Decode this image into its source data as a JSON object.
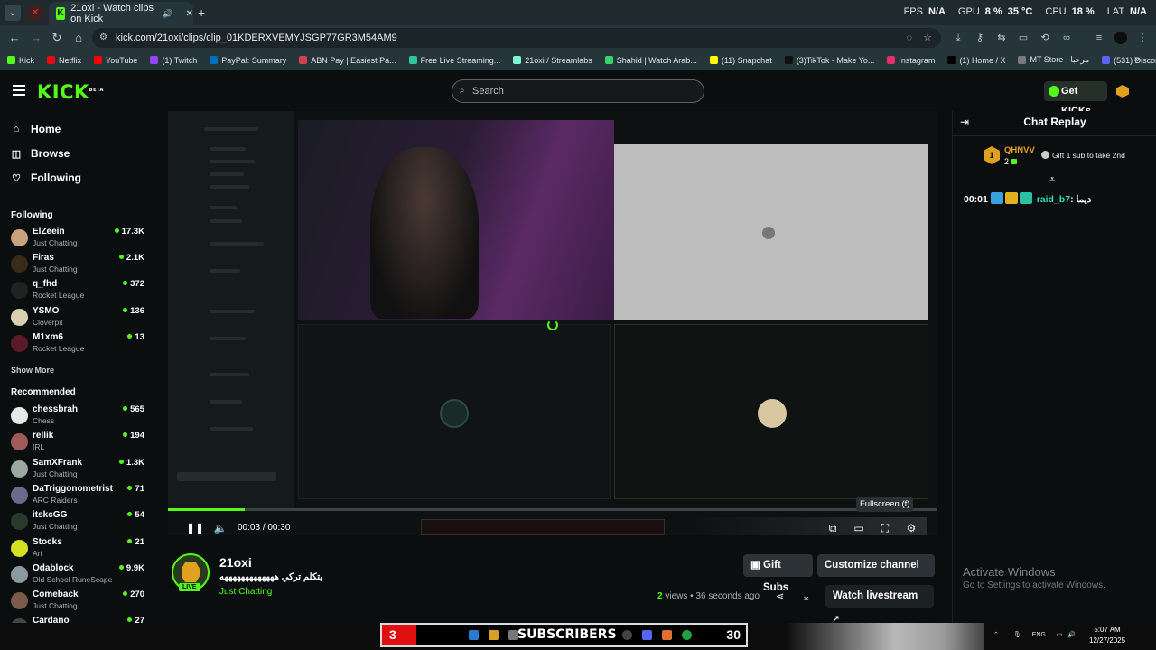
{
  "browser": {
    "tab_title": "21oxi - Watch clips on Kick",
    "url": "kick.com/21oxi/clips/clip_01KDERXVEMYJSGP77GR3M54AM9",
    "perf": {
      "fps_label": "FPS",
      "fps_value": "N/A",
      "gpu_label": "GPU",
      "gpu_value": "8 %",
      "gpu_temp": "35 °C",
      "cpu_label": "CPU",
      "cpu_value": "18 %",
      "lat_label": "LAT",
      "lat_value": "N/A"
    },
    "bookmarks": [
      {
        "label": "Kick",
        "color": "#53fc18"
      },
      {
        "label": "Netflix",
        "color": "#e50914"
      },
      {
        "label": "YouTube",
        "color": "#ff0000"
      },
      {
        "label": "(1) Twitch",
        "color": "#9146ff"
      },
      {
        "label": "PayPal: Summary",
        "color": "#0070ba"
      },
      {
        "label": "ABN Pay | Easiest Pa...",
        "color": "#d04050"
      },
      {
        "label": "Free Live Streaming...",
        "color": "#31c3a2"
      },
      {
        "label": "21oxi / Streamlabs",
        "color": "#80f5d2"
      },
      {
        "label": "Shahid | Watch Arab...",
        "color": "#3ad36a"
      },
      {
        "label": "(11) Snapchat",
        "color": "#fffc00"
      },
      {
        "label": "(3)TikTok - Make Yo...",
        "color": "#111111"
      },
      {
        "label": "Instagram",
        "color": "#e1306c"
      },
      {
        "label": "(1) Home / X",
        "color": "#000000"
      },
      {
        "label": "MT Store - مرحبا",
        "color": "#7a7a7a"
      },
      {
        "label": "(531) Discord | Frien...",
        "color": "#5865f2"
      }
    ]
  },
  "header": {
    "logo": "KICK",
    "logo_tag": "BETA",
    "search_placeholder": "Search",
    "get_kicks": "Get KICKs"
  },
  "sidebar": {
    "nav": [
      "Home",
      "Browse",
      "Following"
    ],
    "following_heading": "Following",
    "following": [
      {
        "name": "ElZeein",
        "category": "Just Chatting",
        "viewers": "17.3K",
        "color": "#c9a27e"
      },
      {
        "name": "Firas",
        "category": "Just Chatting",
        "viewers": "2.1K",
        "color": "#3a2a1a"
      },
      {
        "name": "q_fhd",
        "category": "Rocket League",
        "viewers": "372",
        "color": "#222222"
      },
      {
        "name": "YSMO",
        "category": "Cloverpit",
        "viewers": "136",
        "color": "#d8d0b0"
      },
      {
        "name": "M1xm6",
        "category": "Rocket League",
        "viewers": "13",
        "color": "#5a1a2a"
      }
    ],
    "show_more": "Show More",
    "recommended_heading": "Recommended",
    "recommended": [
      {
        "name": "chessbrah",
        "category": "Chess",
        "viewers": "565",
        "color": "#e8e8e8"
      },
      {
        "name": "rellik",
        "category": "IRL",
        "viewers": "194",
        "color": "#a05a5a"
      },
      {
        "name": "SamXFrank",
        "category": "Just Chatting",
        "viewers": "1.3K",
        "color": "#9aa8a0"
      },
      {
        "name": "DaTriggonometrist",
        "category": "ARC Raiders",
        "viewers": "71",
        "color": "#6a6a8a"
      },
      {
        "name": "itskcGG",
        "category": "Just Chatting",
        "viewers": "54",
        "color": "#2a3a2a"
      },
      {
        "name": "Stocks",
        "category": "Art",
        "viewers": "21",
        "color": "#d4e020"
      },
      {
        "name": "Odablock",
        "category": "Old School RuneScape",
        "viewers": "9.9K",
        "color": "#8a9aa0"
      },
      {
        "name": "Comeback",
        "category": "Just Chatting",
        "viewers": "270",
        "color": "#7a5a4a"
      },
      {
        "name": "Cardano",
        "category": "",
        "viewers": "27",
        "color": "#444444"
      }
    ]
  },
  "player": {
    "current_time": "00:03",
    "separator": "/",
    "duration": "00:30",
    "progress_fraction": 0.1,
    "tooltip": "Fullscreen (f)"
  },
  "channel": {
    "name": "21oxi",
    "title": "يتكلم تركي هههههههههههههه",
    "category": "Just Chatting",
    "live_badge": "LIVE",
    "gift_subs": "Gift Subs",
    "customize": "Customize channel",
    "views_count": "2",
    "views_label": "views",
    "time_ago": "36 seconds ago",
    "watch_livestream": "Watch livestream"
  },
  "chat": {
    "title": "Chat Replay",
    "pinned_user": "QHNVV",
    "pinned_level": "1",
    "pinned_count": "2",
    "pinned_gift": "Gift 1 sub to take 2nd",
    "messages": [
      {
        "time": "00:01",
        "user": "raid_b7",
        "text": "ديما"
      }
    ]
  },
  "watermark": {
    "line1": "Activate Windows",
    "line2": "Go to Settings to activate Windows."
  },
  "taskbar": {
    "sub_count_left": "3",
    "sub_label": "SUBSCRIBERS",
    "sub_count_right": "30",
    "tray_lang": "ENG",
    "time": "5:07 AM",
    "date": "12/27/2025"
  }
}
